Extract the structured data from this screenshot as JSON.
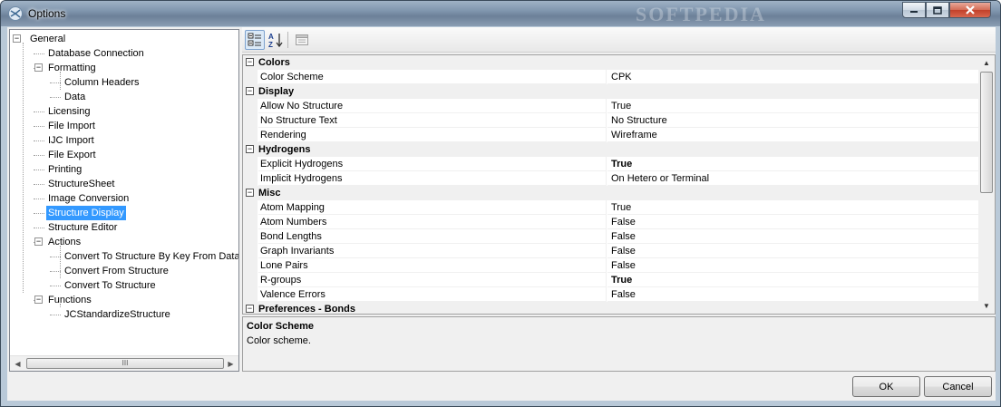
{
  "window": {
    "title": "Options",
    "watermark": "SOFTPEDIA"
  },
  "tree": {
    "nodes": [
      {
        "label": "General",
        "level": 0,
        "expandable": true
      },
      {
        "label": "Database Connection",
        "level": 1
      },
      {
        "label": "Formatting",
        "level": 1,
        "expandable": true
      },
      {
        "label": "Column Headers",
        "level": 2
      },
      {
        "label": "Data",
        "level": 2
      },
      {
        "label": "Licensing",
        "level": 1
      },
      {
        "label": "File Import",
        "level": 1
      },
      {
        "label": "IJC Import",
        "level": 1
      },
      {
        "label": "File Export",
        "level": 1
      },
      {
        "label": "Printing",
        "level": 1
      },
      {
        "label": "StructureSheet",
        "level": 1
      },
      {
        "label": "Image Conversion",
        "level": 1
      },
      {
        "label": "Structure Display",
        "level": 1,
        "selected": true
      },
      {
        "label": "Structure Editor",
        "level": 1
      },
      {
        "label": "Actions",
        "level": 1,
        "expandable": true
      },
      {
        "label": "Convert To Structure By Key From Database",
        "level": 2
      },
      {
        "label": "Convert From Structure",
        "level": 2
      },
      {
        "label": "Convert To Structure",
        "level": 2
      },
      {
        "label": "Functions",
        "level": 1,
        "expandable": true
      },
      {
        "label": "JCStandardizeStructure",
        "level": 2
      }
    ],
    "scrollbar_grip": "III"
  },
  "toolbar": {
    "categorized_icon": "categorized-icon",
    "alphabetical_icon": "alphabetical-icon",
    "property_pages_icon": "property-pages-icon"
  },
  "grid": {
    "rows": [
      {
        "type": "category",
        "label": "Colors"
      },
      {
        "type": "prop",
        "name": "Color Scheme",
        "value": "CPK"
      },
      {
        "type": "category",
        "label": "Display"
      },
      {
        "type": "prop",
        "name": "Allow No Structure",
        "value": "True"
      },
      {
        "type": "prop",
        "name": "No Structure Text",
        "value": "No Structure"
      },
      {
        "type": "prop",
        "name": "Rendering",
        "value": "Wireframe"
      },
      {
        "type": "category",
        "label": "Hydrogens"
      },
      {
        "type": "prop",
        "name": "Explicit Hydrogens",
        "value": "True",
        "bold": true
      },
      {
        "type": "prop",
        "name": "Implicit Hydrogens",
        "value": "On Hetero or Terminal"
      },
      {
        "type": "category",
        "label": "Misc"
      },
      {
        "type": "prop",
        "name": "Atom Mapping",
        "value": "True"
      },
      {
        "type": "prop",
        "name": "Atom Numbers",
        "value": "False"
      },
      {
        "type": "prop",
        "name": "Bond Lengths",
        "value": "False"
      },
      {
        "type": "prop",
        "name": "Graph Invariants",
        "value": "False"
      },
      {
        "type": "prop",
        "name": "Lone Pairs",
        "value": "False"
      },
      {
        "type": "prop",
        "name": "R-groups",
        "value": "True",
        "bold": true
      },
      {
        "type": "prop",
        "name": "Valence Errors",
        "value": "False"
      },
      {
        "type": "category",
        "label": "Preferences - Bonds"
      }
    ]
  },
  "description": {
    "title": "Color Scheme",
    "text": "Color scheme."
  },
  "buttons": {
    "ok": "OK",
    "cancel": "Cancel"
  },
  "colors": {
    "selection": "#3399ff",
    "category_bg": "#f0f0f0"
  }
}
